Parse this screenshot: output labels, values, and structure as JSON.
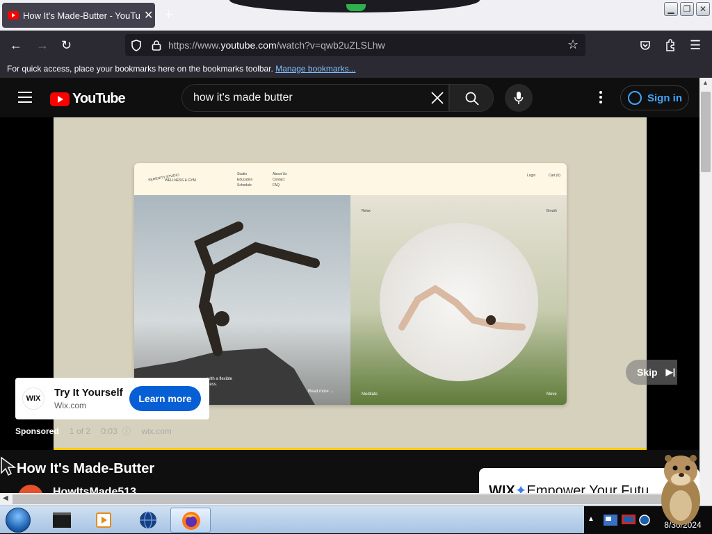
{
  "browser": {
    "tab_title": "How It's Made-Butter - YouTube",
    "new_tab_label": "+",
    "url_prefix": "https://www.",
    "url_domain": "youtube.com",
    "url_path": "/watch?v=qwb2uZLSLhw",
    "bookmarks_hint": "For quick access, place your bookmarks here on the bookmarks toolbar.",
    "bookmarks_link": "Manage bookmarks..."
  },
  "youtube": {
    "logo_text": "YouTube",
    "search_query": "how it's made butter",
    "sign_in": "Sign in"
  },
  "ad": {
    "mock_site": {
      "brand_line1": "SERENITY STUDIO",
      "brand_line2": "WELLNESS & GYM",
      "nav_col1": [
        "Studio",
        "Education",
        "Schedule"
      ],
      "nav_col2": [
        "About Us",
        "Contact",
        "FAQ"
      ],
      "login": "Login",
      "cart": "Cart (0)",
      "relax": "Relax",
      "breath": "Breath",
      "caption_frag": "with a flexible",
      "caption_frag2": "ness.",
      "read_more": "Read more →",
      "meditate": "Meditate",
      "move": "Move"
    },
    "skip_label": "Skip",
    "card_logo": "WIX",
    "card_title": "Try It Yourself",
    "card_domain": "Wix.com",
    "card_cta": "Learn more",
    "sponsored": "Sponsored",
    "ad_count": "1 of 2",
    "ad_time": "0:03",
    "ad_domain": "wix.com"
  },
  "video": {
    "title": "How It's Made-Butter",
    "channel": "HowItsMade513",
    "banner_brand": "WIX",
    "banner_text": "Empower Your Futu"
  },
  "taskbar": {
    "clock_time": "9:",
    "clock_date": "8/30/2024"
  },
  "colors": {
    "yt_red": "#ff0000",
    "signin_blue": "#3ea6ff",
    "cta_blue": "#065fd4",
    "ad_progress": "#ffcc00"
  }
}
